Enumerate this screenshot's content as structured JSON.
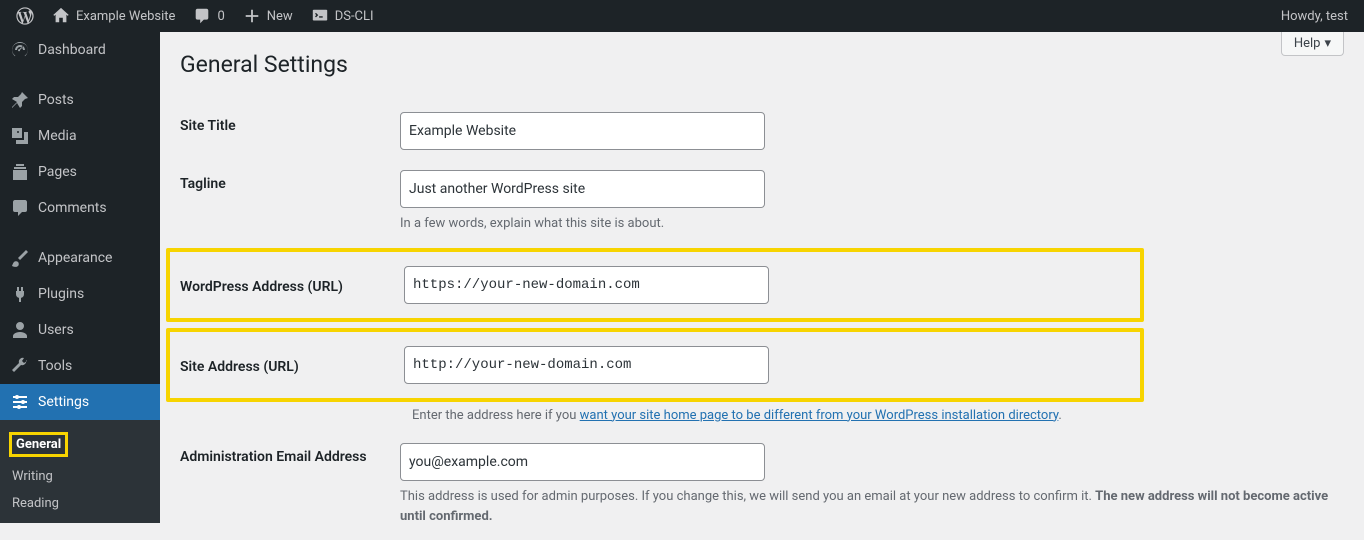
{
  "toolbar": {
    "site_name": "Example Website",
    "comments_count": "0",
    "new_label": "New",
    "dscli_label": "DS-CLI",
    "howdy": "Howdy, test"
  },
  "sidebar": {
    "dashboard": "Dashboard",
    "posts": "Posts",
    "media": "Media",
    "pages": "Pages",
    "comments": "Comments",
    "appearance": "Appearance",
    "plugins": "Plugins",
    "users": "Users",
    "tools": "Tools",
    "settings": "Settings",
    "submenu": {
      "general": "General",
      "writing": "Writing",
      "reading": "Reading"
    }
  },
  "main": {
    "help": "Help",
    "heading": "General Settings",
    "site_title_label": "Site Title",
    "site_title_value": "Example Website",
    "tagline_label": "Tagline",
    "tagline_value": "Just another WordPress site",
    "tagline_desc": "In a few words, explain what this site is about.",
    "wp_url_label": "WordPress Address (URL)",
    "wp_url_value": "https://your-new-domain.com",
    "site_url_label": "Site Address (URL)",
    "site_url_value": "http://your-new-domain.com",
    "site_url_desc_pre": "Enter the address here if you ",
    "site_url_desc_link": "want your site home page to be different from your WordPress installation directory",
    "site_url_desc_post": ".",
    "admin_email_label": "Administration Email Address",
    "admin_email_value": "you@example.com",
    "admin_email_desc_1": "This address is used for admin purposes. If you change this, we will send you an email at your new address to confirm it. ",
    "admin_email_desc_2": "The new address will not become active until confirmed."
  }
}
